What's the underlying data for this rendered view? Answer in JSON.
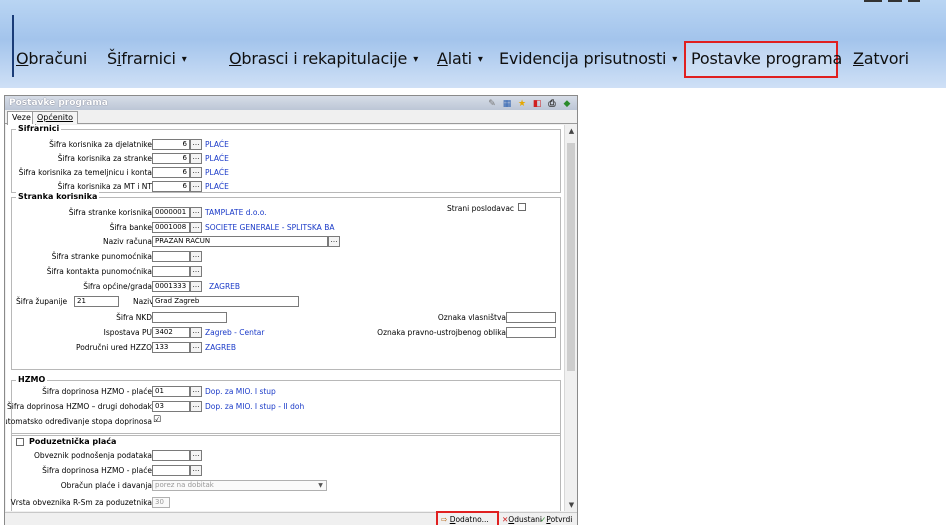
{
  "menu": {
    "items": [
      {
        "acc": "O",
        "rest": "bračuni",
        "caret": false
      },
      {
        "pre": "Š",
        "acc": "i",
        "rest": "frarnici",
        "caret": true
      },
      {
        "acc": "O",
        "rest": "brasci i rekapitulacije",
        "caret": true
      },
      {
        "acc": "A",
        "rest": "lati",
        "caret": true
      },
      {
        "pre": "",
        "acc": "",
        "rest": "Evidencija prisutnosti",
        "caret": true
      },
      {
        "pre": "",
        "acc": "",
        "rest": "Postavke programa",
        "caret": false
      },
      {
        "acc": "Z",
        "rest": "atvori",
        "caret": false
      }
    ],
    "caret_glyph": "▾"
  },
  "window": {
    "title": "Postavke programa",
    "tabs": [
      "Veze",
      "Općenito"
    ],
    "tools": [
      "edit-icon",
      "grid-icon",
      "star-icon",
      "pdf-icon",
      "print-icon",
      "export-icon"
    ]
  },
  "sifrarnici": {
    "title": "Šifrarnici",
    "rows": [
      {
        "label": "Šifra korisnika za djelatnike",
        "value": "6",
        "link": "PLAĆE"
      },
      {
        "label": "Šifra korisnika za stranke",
        "value": "6",
        "link": "PLAĆE"
      },
      {
        "label": "Šifra korisnika za temeljnicu i konta",
        "value": "6",
        "link": "PLAĆE"
      },
      {
        "label": "Šifra korisnika za MT i NT",
        "value": "6",
        "link": "PLAĆE"
      }
    ]
  },
  "stranka": {
    "title": "Stranka korisnika",
    "sifra_stranke": {
      "label": "Šifra stranke korisnika",
      "value": "0000001",
      "link": "TAMPLATE d.o.o."
    },
    "strani_poslodavac": {
      "label": "Strani poslodavac"
    },
    "sifra_banke": {
      "label": "Šifra banke",
      "value": "0001008",
      "link": "SOCIETE GENERALE - SPLITSKA BA"
    },
    "naziv_racuna": {
      "label": "Naziv računa",
      "value": "PRAZAN RAČUN"
    },
    "sifra_punomocnika": {
      "label": "Šifra stranke punomoćnika",
      "value": ""
    },
    "sifra_kontakta": {
      "label": "Šifra kontakta punomoćnika",
      "value": ""
    },
    "sifra_opcine": {
      "label": "Šifra općine/grada",
      "value": "0001333",
      "link": "ZAGREB"
    },
    "sifra_zupanije": {
      "label": "Šifra županije",
      "value": "21"
    },
    "naziv": {
      "label": "Naziv",
      "value": "Grad Zagreb"
    },
    "sifra_nkd": {
      "label": "Šifra NKD",
      "value": ""
    },
    "oznaka_vlasnistva": {
      "label": "Oznaka vlasništva",
      "value": ""
    },
    "ispostava": {
      "label": "Ispostava PU",
      "value": "3402",
      "link": "Zagreb - Centar"
    },
    "oznaka_oblika": {
      "label": "Oznaka pravno-ustrojbenog oblika",
      "value": ""
    },
    "podrucni_ured": {
      "label": "Područni ured HZZO",
      "value": "133",
      "link": "ZAGREB"
    }
  },
  "hzmo": {
    "title": "HZMO",
    "placa": {
      "label": "Šifra doprinosa HZMO - plaće",
      "value": "01",
      "link": "Dop. za MIO. I stup"
    },
    "drugi": {
      "label": "Šifra doprinosa HZMO – drugi dohodak",
      "value": "03",
      "link": "Dop. za MIO. I stup - II doh"
    },
    "auto": {
      "label": "Automatsko određivanje stopa doprinosa",
      "checked": "☑"
    }
  },
  "poduzetnicka": {
    "title": "Poduzetnička plaća",
    "obveznik": {
      "label": "Obveznik podnošenja podataka",
      "value": ""
    },
    "sifra_hzmo": {
      "label": "Šifra doprinosa HZMO - plaće",
      "value": ""
    },
    "obracun": {
      "label": "Obračun plaće i davanja",
      "value": "porez na dobitak"
    },
    "vrsta": {
      "label": "Vrsta obveznika R-Sm za poduzetnika",
      "value": "30"
    }
  },
  "buttons": {
    "dodatno": {
      "acc": "D",
      "rest": "odatno..."
    },
    "odustani": {
      "acc": "O",
      "rest": "dustani"
    },
    "potvrdi": {
      "acc": "P",
      "rest": "otvrdi"
    }
  },
  "colors": {
    "link": "#1a3ac8",
    "highlight": "#e02020",
    "menubar": "#a3c4ec"
  }
}
